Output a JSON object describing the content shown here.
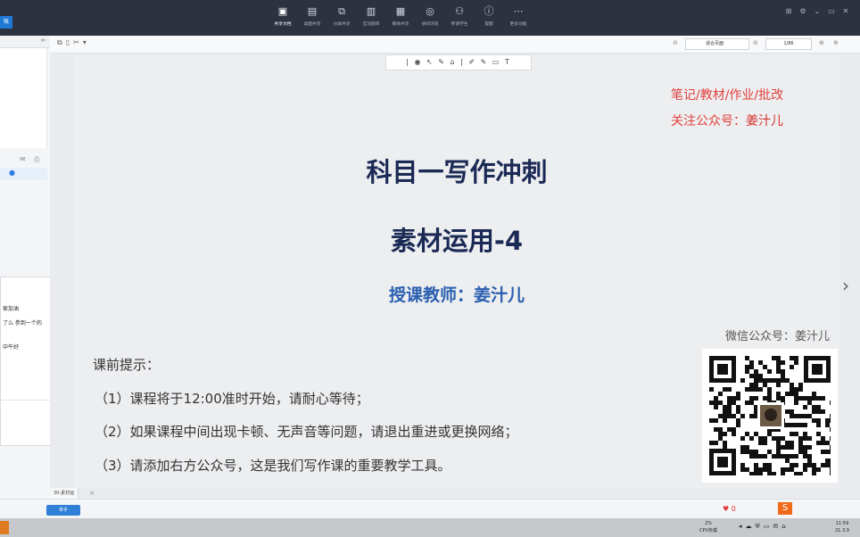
{
  "top_toolbar": {
    "app_badge": "帐",
    "tools": [
      {
        "id": "share-doc",
        "icon": "document-share-icon",
        "glyph": "▣",
        "label": "共享文档",
        "active": true
      },
      {
        "id": "share-desktop",
        "icon": "desktop-share-icon",
        "glyph": "▤",
        "label": "桌面共享",
        "active": false
      },
      {
        "id": "screen-share",
        "icon": "screen-share-icon",
        "glyph": "⧉",
        "label": "分屏共享",
        "active": false
      },
      {
        "id": "interactive",
        "icon": "chart-icon",
        "glyph": "▥",
        "label": "互动题目",
        "active": false
      },
      {
        "id": "media-share",
        "icon": "media-icon",
        "glyph": "▦",
        "label": "媒体共享",
        "active": false
      },
      {
        "id": "browser",
        "icon": "compass-icon",
        "glyph": "◎",
        "label": "协同浏览",
        "active": false
      },
      {
        "id": "participants",
        "icon": "users-icon",
        "glyph": "⚇",
        "label": "参课学生",
        "active": false
      },
      {
        "id": "notice",
        "icon": "info-icon",
        "glyph": "ⓘ",
        "label": "提醒",
        "active": false
      },
      {
        "id": "more",
        "icon": "more-icon",
        "glyph": "⋯",
        "label": "更多功能",
        "active": false
      }
    ]
  },
  "chat": {
    "messages": [
      "家加油",
      "了么 参到一个的",
      "中午好"
    ]
  },
  "doc_toolbar": {
    "fit_option": "适合页面",
    "page_indicator": "1/86"
  },
  "annotation_tools": "| ◉ ↖ ✎ ⌂ | ✐ ✎ ▭ T",
  "slide": {
    "notes_line1": "笔记/教材/作业/批改",
    "notes_line2_prefix": "关注公众号：",
    "notes_line2_name": "姜汁儿",
    "title": "科目一写作冲刺",
    "subtitle": "素材运用-4",
    "teacher": "授课教师：姜汁儿",
    "wechat_label": "微信公众号：姜汁儿",
    "tips_title": "课前提示：",
    "tips": [
      "（1）课程将于12:00准时开始，请耐心等待；",
      "（2）如果课程中间出现卡顿、无声音等问题，请退出重进或更换网络；",
      "（3）请添加右方公众号，这是我们写作课的重要教学工具。"
    ],
    "colors": {
      "red": "#e0403b",
      "navy": "#1b2a55",
      "blue": "#2a5fb0"
    }
  },
  "tabstrip": {
    "file": "30-素材运"
  },
  "bottombar": {
    "hand_button": "举手",
    "like_count": "0"
  },
  "taskbar": {
    "cpu_percent": "2%",
    "cpu_label": "CPU负载",
    "time": "11:59",
    "date": "21.3.9"
  }
}
